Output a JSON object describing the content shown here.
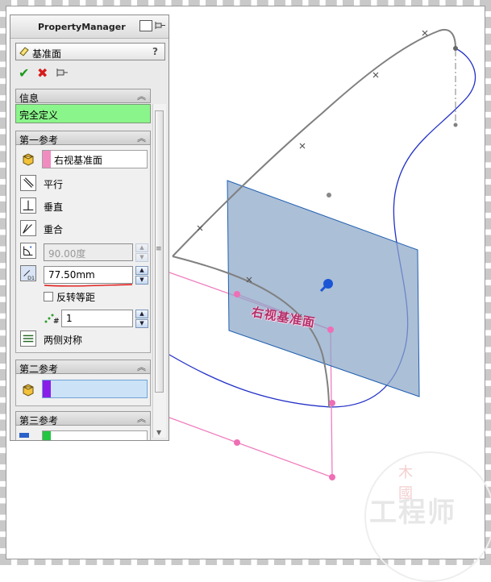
{
  "property_manager": {
    "title": "PropertyManager",
    "feature_name": "基准面",
    "help": "?",
    "actions": {
      "ok": "✔",
      "cancel": "✖"
    },
    "info_group": {
      "label": "信息",
      "status": "完全定义"
    },
    "first_reference": {
      "label": "第一参考",
      "selection": "右视基准面",
      "chip_color": "#f08cc0",
      "options": [
        "平行",
        "垂直",
        "重合"
      ],
      "angle_value": "90.00度",
      "distance_value": "77.50mm",
      "flip_label": "反转等距",
      "count_value": "1",
      "symmetric_label": "两侧对称"
    },
    "second_reference": {
      "label": "第二参考",
      "chip_color": "#8a1ee8"
    },
    "third_reference": {
      "label": "第三参考",
      "chip_color": "#22c640"
    }
  },
  "viewport": {
    "plane_label": "右视基准面",
    "plane_color": "#8aa6c8"
  },
  "watermark": {
    "top": "木 國",
    "text": "工程师"
  }
}
